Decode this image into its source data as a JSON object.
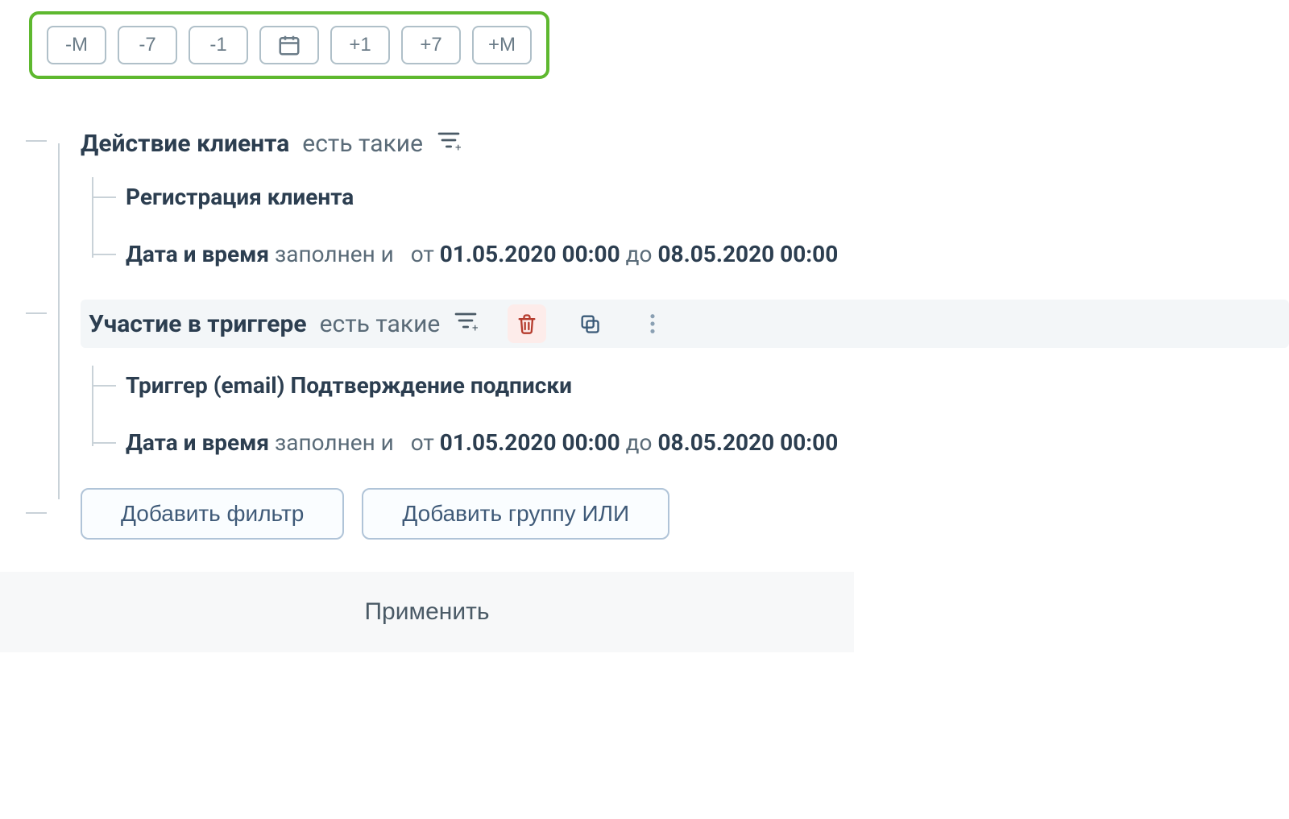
{
  "date_shift": {
    "buttons": [
      "-M",
      "-7",
      "-1",
      "today",
      "+1",
      "+7",
      "+M"
    ]
  },
  "filters": {
    "groups": [
      {
        "title": "Действие клиента",
        "condition": "есть такие",
        "selected": false,
        "items": [
          {
            "label": "Регистрация клиента"
          },
          {
            "label": "Дата и время",
            "state": "заполнен и",
            "from_prefix": "от",
            "from": "01.05.2020 00:00",
            "to_prefix": "до",
            "to": "08.05.2020 00:00"
          }
        ]
      },
      {
        "title": "Участие в триггере",
        "condition": "есть такие",
        "selected": true,
        "items": [
          {
            "label": "Триггер  (email) Подтверждение подписки"
          },
          {
            "label": "Дата и время",
            "state": "заполнен и",
            "from_prefix": "от",
            "from": "01.05.2020 00:00",
            "to_prefix": "до",
            "to": "08.05.2020 00:00"
          }
        ]
      }
    ],
    "add_filter_label": "Добавить фильтр",
    "add_or_group_label": "Добавить группу ИЛИ"
  },
  "apply_label": "Применить"
}
